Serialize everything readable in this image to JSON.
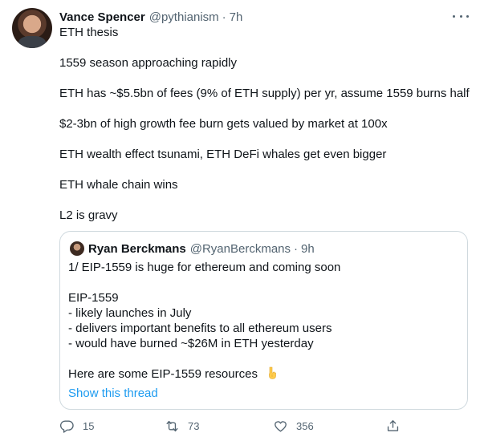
{
  "tweet": {
    "author_name": "Vance Spencer",
    "author_handle": "@pythianism",
    "separator": "·",
    "time": "7h",
    "lines": [
      "ETH thesis",
      "1559 season approaching rapidly",
      "ETH has  ~$5.5bn of fees (9% of ETH supply) per yr, assume 1559 burns half",
      "$2-3bn of high growth fee burn gets valued by market at 100x",
      "ETH wealth effect tsunami, ETH DeFi whales get even bigger",
      "ETH whale chain wins",
      "L2 is gravy"
    ]
  },
  "quote": {
    "author_name": "Ryan Berckmans",
    "author_handle": "@RyanBerckmans",
    "separator": "·",
    "time": "9h",
    "lines": [
      "1/ EIP-1559 is huge for ethereum and coming soon",
      "EIP-1559",
      "- likely launches in July",
      "- delivers important benefits to all ethereum users",
      "- would have burned ~$26M in ETH yesterday",
      "Here are some EIP-1559 resources"
    ],
    "emoji": "backhand-index-pointing-down",
    "show_thread": "Show this thread"
  },
  "actions": {
    "reply_count": "15",
    "retweet_count": "73",
    "like_count": "356"
  },
  "colors": {
    "text": "#0f1419",
    "secondary": "#536471",
    "link": "#1d9bf0",
    "border": "#cfd9de"
  }
}
